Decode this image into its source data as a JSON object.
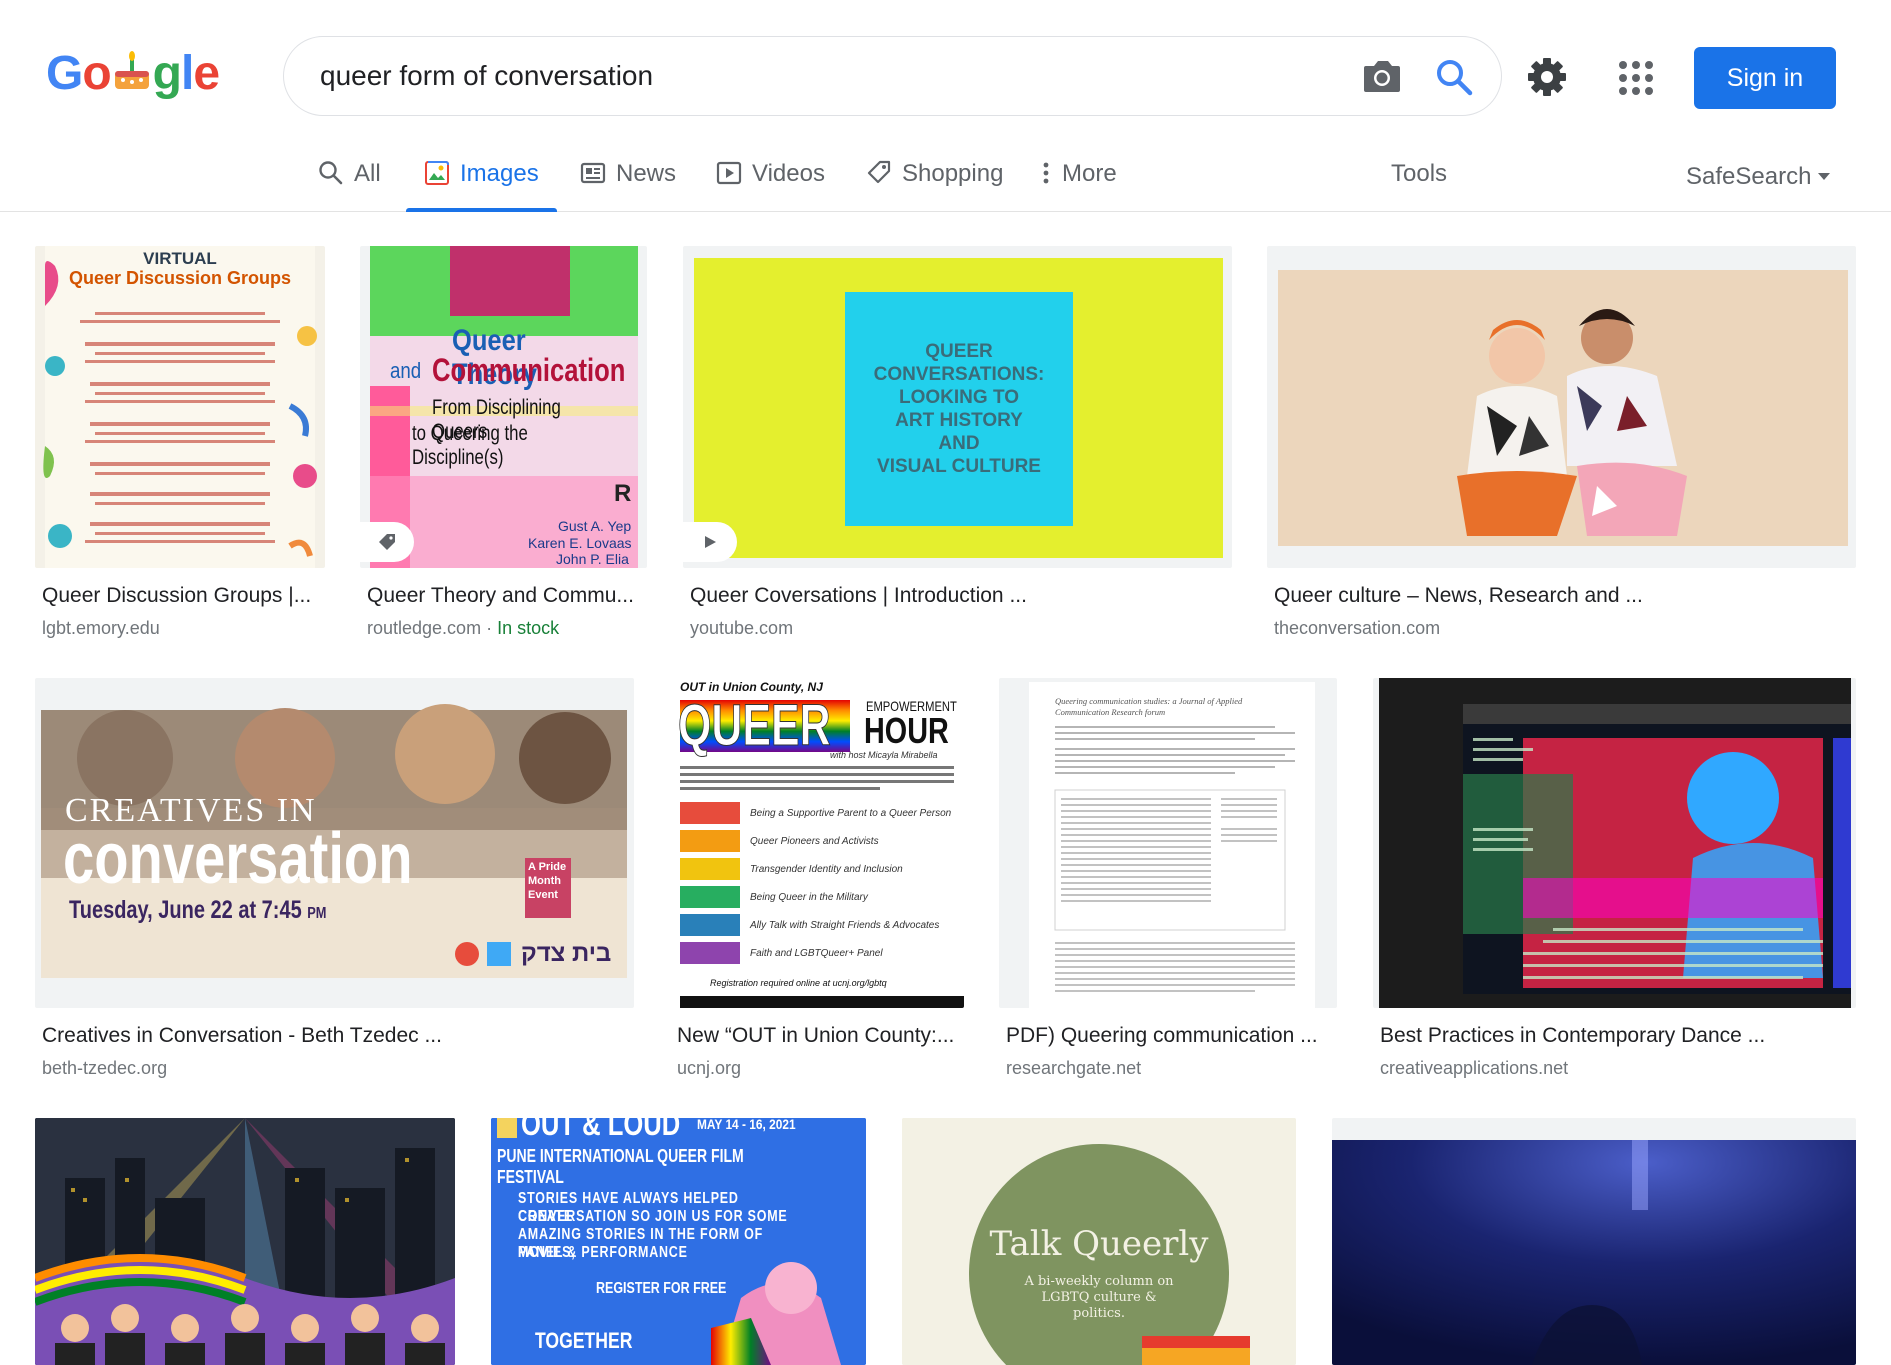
{
  "header": {
    "logo_letters": [
      "G",
      "o",
      "g",
      "l",
      "e"
    ],
    "logo_colors": [
      "#4285f4",
      "#ea4335",
      "#34a853",
      "#4285f4",
      "#ea4335"
    ],
    "search_query": "queer form of conversation",
    "sign_in_label": "Sign in"
  },
  "tabs": [
    {
      "label": "All",
      "icon": "search-icon",
      "active": false
    },
    {
      "label": "Images",
      "icon": "image-icon",
      "active": true
    },
    {
      "label": "News",
      "icon": "newspaper-icon",
      "active": false
    },
    {
      "label": "Videos",
      "icon": "play-icon",
      "active": false
    },
    {
      "label": "Shopping",
      "icon": "tag-icon",
      "active": false
    },
    {
      "label": "More",
      "icon": "more-vert-icon",
      "active": false
    }
  ],
  "tools_label": "Tools",
  "safesearch_label": "SafeSearch",
  "results": [
    {
      "caption": "Queer Discussion Groups |...",
      "source": "lgbt.emory.edu",
      "thumb_text": [
        "VIRTUAL",
        "Queer Discussion Groups"
      ]
    },
    {
      "caption": "Queer Theory and Commu...",
      "source": "routledge.com",
      "availability": "In stock",
      "thumb_text": [
        "Queer Theory",
        "and",
        "Communication",
        "From Disciplining Queers",
        "to Queering the Discipline(s)",
        "Gust A. Yep",
        "Karen E. Lovaas",
        "John P. Elia"
      ]
    },
    {
      "caption": "Queer Coversations | Introduction ...",
      "source": "youtube.com",
      "thumb_text": [
        "QUEER",
        "CONVERSATIONS:",
        "LOOKING TO",
        "ART HISTORY",
        "AND",
        "VISUAL CULTURE"
      ]
    },
    {
      "caption": "Queer culture – News, Research and ...",
      "source": "theconversation.com"
    },
    {
      "caption": "Creatives in Conversation - Beth Tzedec ...",
      "source": "beth-tzedec.org",
      "thumb_text": [
        "CREATIVES IN",
        "conversation",
        "A Pride Month Event",
        "Tuesday, June 22 at 7:45",
        "PM",
        "בית צדק"
      ]
    },
    {
      "caption": "New “OUT in Union County:...",
      "source": "ucnj.org",
      "thumb_text": [
        "OUT in Union County, NJ",
        "QUEER",
        "EMPOWERMENT",
        "HOUR",
        "with host Micayla Mirabella",
        "Being a Supportive Parent to a Queer Person",
        "Queer Pioneers and Activists",
        "Transgender Identity and Inclusion",
        "Being Queer in the Military",
        "Ally Talk with Straight Friends & Advocates",
        "Faith and LGBTQueer+ Panel",
        "Registration required online at ucnj.org/lgbtq"
      ]
    },
    {
      "caption": "PDF) Queering communication ...",
      "source": "researchgate.net",
      "thumb_text": [
        "Queering communication studies: a Journal of Applied",
        "Communication Research forum"
      ]
    },
    {
      "caption": "Best Practices in Contemporary Dance ...",
      "source": "creativeapplications.net"
    },
    {
      "thumb_text": []
    },
    {
      "thumb_text": [
        "OUT & LOUD",
        "MAY 14 - 16, 2021",
        "PUNE INTERNATIONAL QUEER FILM FESTIVAL",
        "STORIES HAVE ALWAYS HELPED CREATE",
        "CONVERSATION SO JOIN US FOR SOME",
        "AMAZING STORIES IN THE FORM OF MOVIES,",
        "PANEL & PERFORMANCE",
        "REGISTER FOR FREE",
        "TOGETHER"
      ]
    },
    {
      "thumb_text": [
        "Talk Queerly",
        "A bi-weekly column on",
        "LGBTQ culture &",
        "politics."
      ]
    },
    {
      "thumb_text": []
    }
  ]
}
